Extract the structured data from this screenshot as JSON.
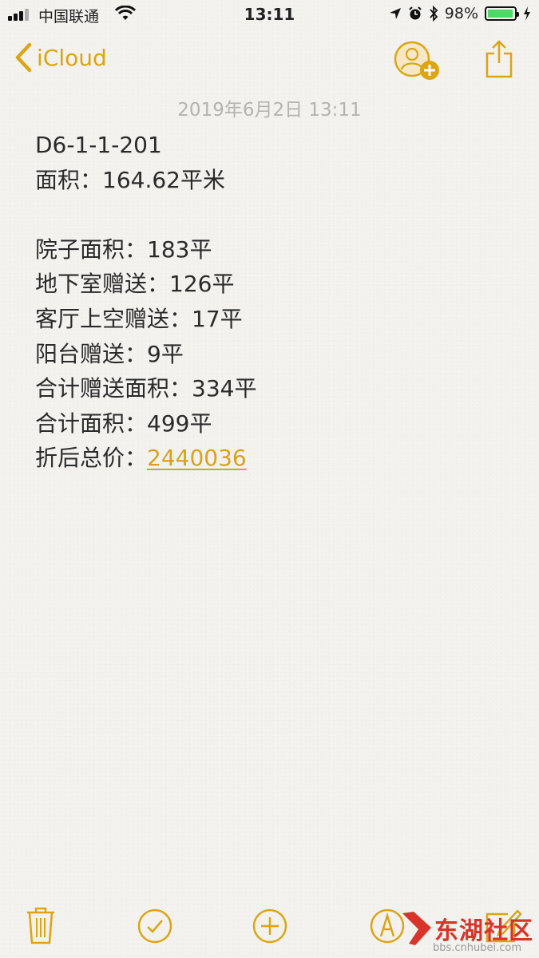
{
  "status_bar": {
    "carrier": "中国联通",
    "time": "13:11",
    "battery": "98%",
    "battery_level": 0.98,
    "icons": [
      "signal-icon",
      "wifi-icon",
      "location-icon",
      "alarm-icon",
      "bluetooth-icon",
      "battery-icon",
      "charging-icon"
    ]
  },
  "nav": {
    "back_label": "iCloud",
    "icons": [
      "chevron-left-icon",
      "add-person-icon",
      "share-icon"
    ]
  },
  "note": {
    "date": "2019年6月2日 13:11",
    "lines": {
      "l0": "D6-1-1-201",
      "l1": "面积：164.62平米",
      "l3": "院子面积：183平",
      "l4": "地下室赠送：126平",
      "l5": "客厅上空赠送：17平",
      "l6": "阳台赠送：9平",
      "l7": "合计赠送面积：334平",
      "l8": "合计面积：499平",
      "l9_label": "折后总价：",
      "l9_value": "2440036"
    }
  },
  "toolbar": {
    "icons": [
      "trash-icon",
      "checklist-icon",
      "add-icon",
      "markup-icon",
      "compose-icon"
    ]
  },
  "watermark": {
    "text": "东湖社区",
    "url": "bbs.cnhubei.com"
  },
  "colors": {
    "accent": "#dba513",
    "date": "#b4b3b0",
    "battery": "#4cd964",
    "watermark": "#d7342a"
  }
}
